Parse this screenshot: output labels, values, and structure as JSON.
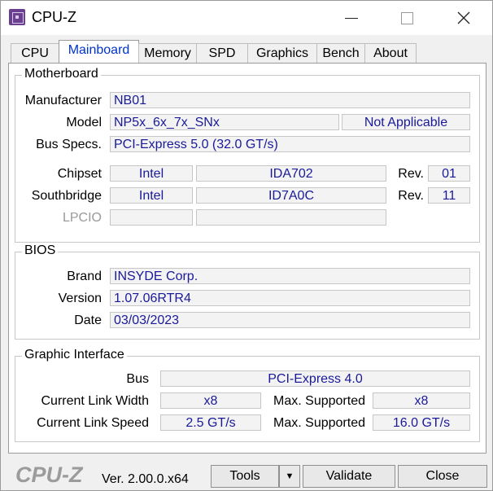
{
  "window": {
    "title": "CPU-Z"
  },
  "tabs": [
    "CPU",
    "Mainboard",
    "Memory",
    "SPD",
    "Graphics",
    "Bench",
    "About"
  ],
  "motherboard": {
    "section_title": "Motherboard",
    "manufacturer_label": "Manufacturer",
    "manufacturer": "NB01",
    "model_label": "Model",
    "model": "NP5x_6x_7x_SNx",
    "model_extra": "Not Applicable",
    "bus_label": "Bus Specs.",
    "bus": "PCI-Express 5.0 (32.0 GT/s)",
    "chipset_label": "Chipset",
    "chipset_vendor": "Intel",
    "chipset_model": "IDA702",
    "chipset_rev_label": "Rev.",
    "chipset_rev": "01",
    "southbridge_label": "Southbridge",
    "southbridge_vendor": "Intel",
    "southbridge_model": "ID7A0C",
    "southbridge_rev_label": "Rev.",
    "southbridge_rev": "11",
    "lpcio_label": "LPCIO"
  },
  "bios": {
    "section_title": "BIOS",
    "brand_label": "Brand",
    "brand": "INSYDE Corp.",
    "version_label": "Version",
    "version": "1.07.06RTR4",
    "date_label": "Date",
    "date": "03/03/2023"
  },
  "graphic": {
    "section_title": "Graphic Interface",
    "bus_label": "Bus",
    "bus": "PCI-Express 4.0",
    "link_width_label": "Current Link Width",
    "link_width": "x8",
    "max_width_label": "Max. Supported",
    "max_width": "x8",
    "link_speed_label": "Current Link Speed",
    "link_speed": "2.5 GT/s",
    "max_speed_label": "Max. Supported",
    "max_speed": "16.0 GT/s"
  },
  "footer": {
    "logo": "CPU-Z",
    "version": "Ver. 2.00.0.x64",
    "tools": "Tools",
    "validate": "Validate",
    "close": "Close"
  }
}
